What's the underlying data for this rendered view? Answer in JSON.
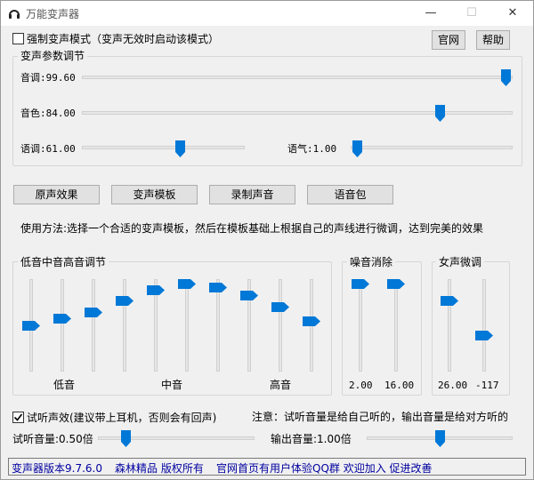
{
  "window": {
    "title": "万能变声器",
    "minimize": "—",
    "maximize": "☐",
    "close": "✕"
  },
  "top": {
    "force_mode_label": "强制变声模式（变声无效时启动该模式）",
    "force_mode_checked": false,
    "website_button": "官网",
    "help_button": "帮助"
  },
  "params": {
    "title": "变声参数调节",
    "pitch_label": "音调:99.60",
    "pitch_value": 99.6,
    "timbre_label": "音色:84.00",
    "timbre_value": 84.0,
    "speed_label": "语调:61.00",
    "speed_value": 61.0,
    "tone_label": "语气:1.00",
    "tone_value": 1.0
  },
  "actions": {
    "original": "原声效果",
    "template": "变声模板",
    "record": "录制声音",
    "voice_pack": "语音包"
  },
  "usage": "使用方法:选择一个合适的变声模板，然后在模板基础上根据自己的声线进行微调，达到完美的效果",
  "eq": {
    "title": "低音中音高音调节",
    "low_label": "低音",
    "mid_label": "中音",
    "high_label": "高音",
    "bands": [
      0.5,
      0.58,
      0.66,
      0.8,
      0.92,
      1.0,
      0.96,
      0.86,
      0.72,
      0.55
    ]
  },
  "noise": {
    "title": "噪音消除",
    "values": [
      "2.00",
      "16.00"
    ],
    "levels": [
      1.0,
      1.0
    ]
  },
  "female": {
    "title": "女声微调",
    "values": [
      "26.00",
      "-117"
    ],
    "levels": [
      0.8,
      0.38
    ]
  },
  "monitor": {
    "label": "试听声效(建议带上耳机，否则会有回声)",
    "checked": true,
    "note": "注意：试听音量是给自己听的，输出音量是给对方听的",
    "listen_label": "试听音量:0.50倍",
    "listen_value": 0.5,
    "output_label": "输出音量:1.00倍",
    "output_value": 1.0
  },
  "status": {
    "version": "变声器版本9.7.6.0",
    "copyright": "森林精品 版权所有",
    "link": "官网首页有用户体验QQ群 欢迎加入 促进改善"
  },
  "colors": {
    "thumb": "#0078d7",
    "status_text": "#0000a0"
  }
}
